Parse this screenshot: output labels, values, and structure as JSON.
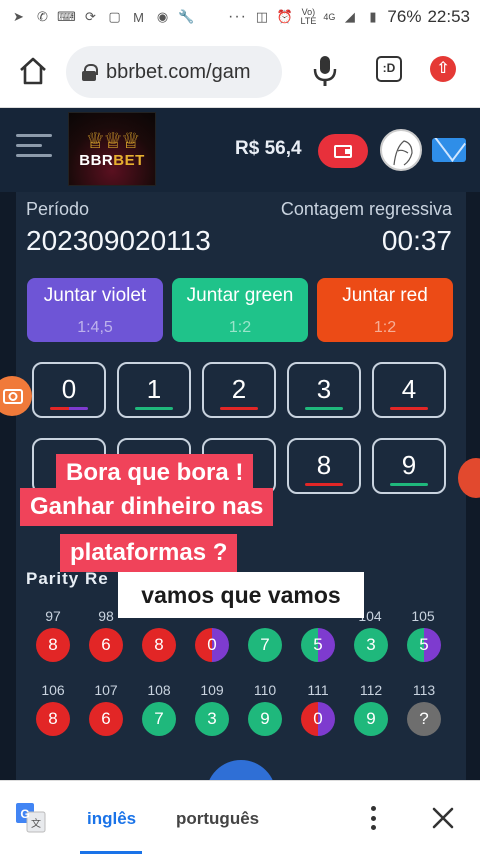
{
  "status_bar": {
    "battery": "76%",
    "time": "22:53",
    "net_small": "Vo)\nLTE",
    "net_4g": "4G"
  },
  "browser": {
    "url": "bbrbet.com/gam",
    "tab_label": ":D"
  },
  "header": {
    "logo_text_left": "BBR",
    "logo_text_right": "BET",
    "balance": "R$ 56,4"
  },
  "game": {
    "period_label": "Período",
    "period_value": "202309020113",
    "countdown_label": "Contagem regressiva",
    "countdown_value": "00:37",
    "join_buttons": [
      {
        "label": "Juntar violet",
        "odds": "1:4,5"
      },
      {
        "label": "Juntar green",
        "odds": "1:2"
      },
      {
        "label": "Juntar red",
        "odds": "1:2"
      }
    ],
    "numbers_row1": [
      "0",
      "1",
      "2",
      "3",
      "4"
    ],
    "numbers_row2_visible": [
      "8",
      "9"
    ],
    "parity_title": "Parity Re",
    "history_row1": [
      {
        "issue": "97",
        "value": "8"
      },
      {
        "issue": "98",
        "value": "6"
      },
      {
        "issue": "",
        "value": "8"
      },
      {
        "issue": "",
        "value": "0"
      },
      {
        "issue": "",
        "value": "7"
      },
      {
        "issue": "",
        "value": "5"
      },
      {
        "issue": "104",
        "value": "3"
      },
      {
        "issue": "105",
        "value": "5"
      }
    ],
    "history_row2": [
      {
        "issue": "106",
        "value": "8"
      },
      {
        "issue": "107",
        "value": "6"
      },
      {
        "issue": "108",
        "value": "7"
      },
      {
        "issue": "109",
        "value": "3"
      },
      {
        "issue": "110",
        "value": "9"
      },
      {
        "issue": "111",
        "value": "0"
      },
      {
        "issue": "112",
        "value": "9"
      },
      {
        "issue": "113",
        "value": "?"
      }
    ]
  },
  "overlay_captions": {
    "line1": "Bora que bora !",
    "line2": "Ganhar dinheiro nas",
    "line3": "plataformas  ?",
    "white": "vamos que vamos"
  },
  "translate_bar": {
    "lang_active": "inglês",
    "lang_other": "português"
  },
  "colors": {
    "violet": "#6e55d6",
    "green": "#1fc38a",
    "red": "#ec4b16",
    "caption_bg": "#f0435a"
  }
}
